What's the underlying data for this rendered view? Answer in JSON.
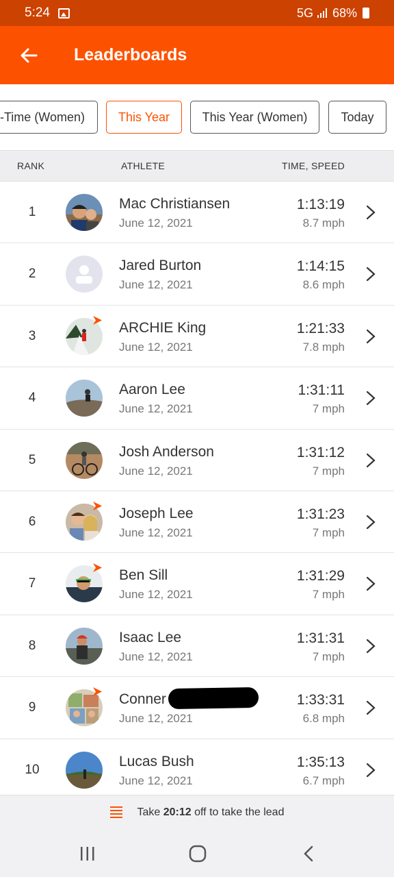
{
  "status": {
    "time": "5:24",
    "network": "5G",
    "battery": "68%"
  },
  "header": {
    "title": "Leaderboards"
  },
  "filters": [
    {
      "label": "-Time (Women)",
      "active": false
    },
    {
      "label": "This Year",
      "active": true
    },
    {
      "label": "This Year (Women)",
      "active": false
    },
    {
      "label": "Today",
      "active": false
    }
  ],
  "table": {
    "columns": {
      "rank": "RANK",
      "athlete": "ATHLETE",
      "time": "TIME, SPEED"
    },
    "rows": [
      {
        "rank": "1",
        "name": "Mac Christiansen",
        "date": "June 12, 2021",
        "time": "1:13:19",
        "speed": "8.7 mph",
        "subscriber": false
      },
      {
        "rank": "2",
        "name": "Jared Burton",
        "date": "June 12, 2021",
        "time": "1:14:15",
        "speed": "8.6 mph",
        "subscriber": false
      },
      {
        "rank": "3",
        "name": "ARCHIE King",
        "date": "June 12, 2021",
        "time": "1:21:33",
        "speed": "7.8 mph",
        "subscriber": true
      },
      {
        "rank": "4",
        "name": "Aaron Lee",
        "date": "June 12, 2021",
        "time": "1:31:11",
        "speed": "7 mph",
        "subscriber": false
      },
      {
        "rank": "5",
        "name": "Josh Anderson",
        "date": "June 12, 2021",
        "time": "1:31:12",
        "speed": "7 mph",
        "subscriber": false
      },
      {
        "rank": "6",
        "name": "Joseph Lee",
        "date": "June 12, 2021",
        "time": "1:31:23",
        "speed": "7 mph",
        "subscriber": true
      },
      {
        "rank": "7",
        "name": "Ben Sill",
        "date": "June 12, 2021",
        "time": "1:31:29",
        "speed": "7 mph",
        "subscriber": true
      },
      {
        "rank": "8",
        "name": "Isaac Lee",
        "date": "June 12, 2021",
        "time": "1:31:31",
        "speed": "7 mph",
        "subscriber": false
      },
      {
        "rank": "9",
        "name": "Conner",
        "date": "June 12, 2021",
        "time": "1:33:31",
        "speed": "6.8 mph",
        "subscriber": true
      },
      {
        "rank": "10",
        "name": "Lucas Bush",
        "date": "June 12, 2021",
        "time": "1:35:13",
        "speed": "6.7 mph",
        "subscriber": false
      }
    ]
  },
  "lead": {
    "prefix": "Take ",
    "amount": "20:12",
    "suffix": " off to take the lead"
  },
  "colors": {
    "brand": "#fc5200",
    "status_bar": "#cc4200"
  }
}
